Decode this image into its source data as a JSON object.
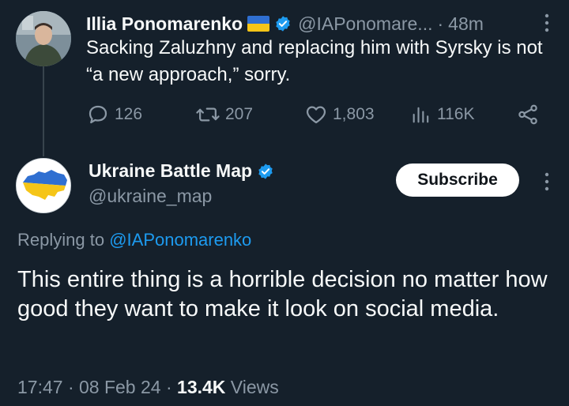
{
  "parent_tweet": {
    "author_name": "Illia Ponomarenko",
    "handle": "@IAPonomare...",
    "separator": "·",
    "time_ago": "48m",
    "text": "Sacking Zaluzhny and replacing him with Syrsky is not “a new approach,” sorry.",
    "metrics": {
      "replies": "126",
      "reposts": "207",
      "likes": "1,803",
      "views": "116K"
    },
    "icons": [
      "flag-ukraine-icon",
      "verified-badge-icon",
      "more-options-icon",
      "reply-icon",
      "repost-icon",
      "like-icon",
      "views-icon",
      "share-icon"
    ]
  },
  "reply_tweet": {
    "author_name": "Ukraine Battle Map",
    "handle": "@ukraine_map",
    "subscribe_label": "Subscribe",
    "replying_prefix": "Replying to",
    "replying_handle": "@IAPonomarenko",
    "text": "This entire thing is a horrible decision no matter how good they want to make it look on social media.",
    "timestamp": "17:47 · 08 Feb 24",
    "separator": "·",
    "views_count": "13.4K",
    "views_label": "Views"
  },
  "colors": {
    "background": "#15202b",
    "text_primary": "#f7f9f9",
    "text_secondary": "#8b98a5",
    "accent": "#1d9bf0",
    "button_bg": "#ffffff"
  }
}
